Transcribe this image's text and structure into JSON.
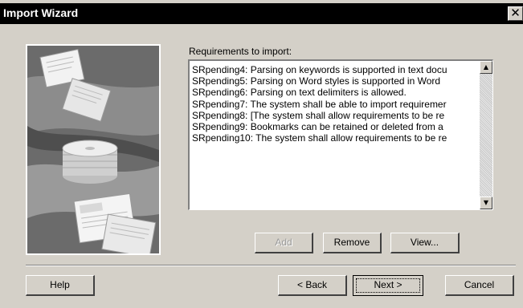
{
  "window": {
    "title": "Import Wizard",
    "close_glyph": "✕"
  },
  "requirements_label": "Requirements to import:",
  "requirements": [
    "SRpending4: Parsing on keywords is supported in text docu",
    "SRpending5: Parsing on Word styles is supported in Word",
    "SRpending6: Parsing on text delimiters is allowed.",
    "SRpending7: The system shall be able to import requiremer",
    "SRpending8: [The system shall allow requirements to be re",
    "SRpending9: Bookmarks can be retained or deleted from a",
    "SRpending10: The system shall allow requirements to be re"
  ],
  "buttons": {
    "add": {
      "label": "Add",
      "enabled": false
    },
    "remove": {
      "label": "Remove",
      "enabled": true
    },
    "view": {
      "label": "View...",
      "enabled": true
    },
    "help": {
      "label": "Help"
    },
    "back": {
      "label": "< Back"
    },
    "next": {
      "label": "Next >"
    },
    "cancel": {
      "label": "Cancel"
    }
  },
  "scrollbar": {
    "up_glyph": "▲",
    "down_glyph": "▼"
  },
  "colors": {
    "dialog_face": "#d4d0c8",
    "title_bar": "#000000",
    "title_text": "#ffffff",
    "list_bg": "#ffffff"
  },
  "icons": [
    "close-icon",
    "scroll-up-arrow-icon",
    "scroll-down-arrow-icon",
    "wizard-illustration"
  ]
}
